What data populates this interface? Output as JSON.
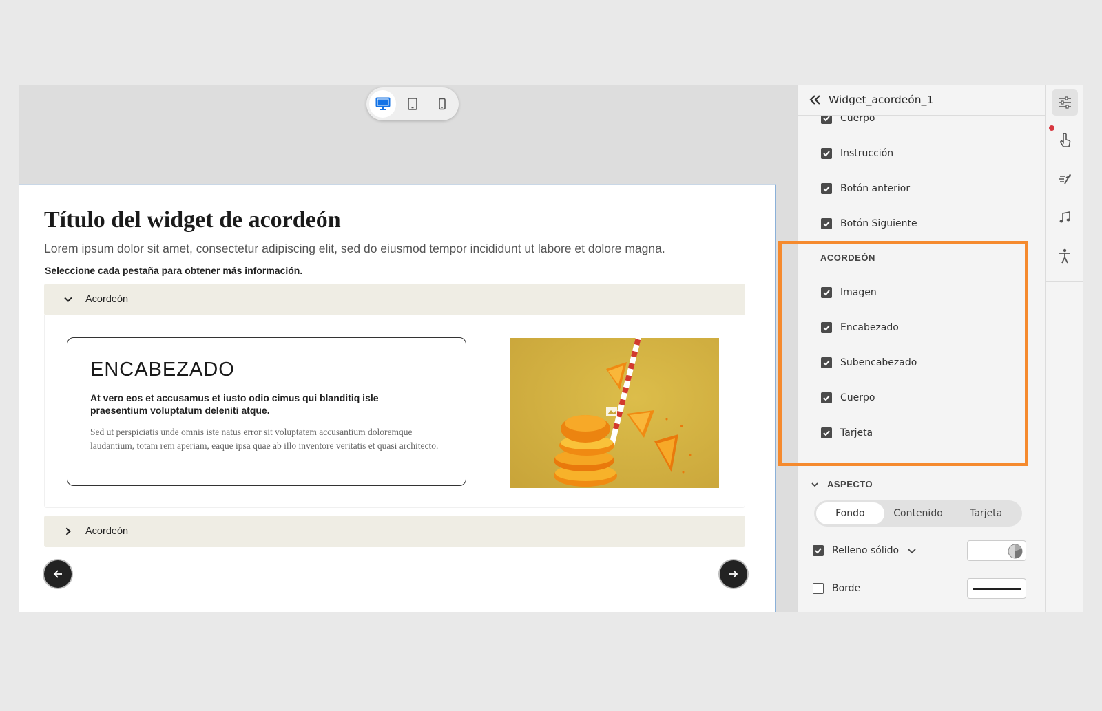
{
  "device_bar": {
    "options": [
      "desktop-icon",
      "tablet-icon",
      "mobile-icon"
    ],
    "active": "desktop-icon",
    "active_color": "#1473e6"
  },
  "widget": {
    "title": "Título del widget de acordeón",
    "description": "Lorem ipsum dolor sit amet, consectetur adipiscing elit, sed do eiusmod tempor incididunt ut labore et dolore magna.",
    "instruction": "Seleccione cada pestaña para obtener más información.",
    "accordions": [
      {
        "label": "Acordeón",
        "expanded": true,
        "card": {
          "heading": "ENCABEZADO",
          "subheading": "At vero eos et accusamus et iusto odio cimus qui blanditiq isle praesentium voluptatum deleniti atque.",
          "body": "Sed ut perspiciatis unde omnis iste natus error sit voluptatem accusantium doloremque laudantium, totam rem aperiam, eaque ipsa quae ab illo inventore veritatis et quasi architecto."
        }
      },
      {
        "label": "Acordeón",
        "expanded": false
      }
    ],
    "accordion_header_color": "#efede4"
  },
  "panel": {
    "title": "Widget_acordeón_1",
    "general_items": [
      {
        "label": "Cuerpo",
        "checked": true
      },
      {
        "label": "Instrucción",
        "checked": true
      },
      {
        "label": "Botón anterior",
        "checked": true
      },
      {
        "label": "Botón Siguiente",
        "checked": true
      }
    ],
    "accordion_section": {
      "title": "ACORDEÓN",
      "items": [
        {
          "label": "Imagen",
          "checked": true
        },
        {
          "label": "Encabezado",
          "checked": true
        },
        {
          "label": "Subencabezado",
          "checked": true
        },
        {
          "label": "Cuerpo",
          "checked": true
        },
        {
          "label": "Tarjeta",
          "checked": true
        }
      ]
    },
    "appearance": {
      "title": "ASPECTO",
      "tabs": [
        "Fondo",
        "Contenido",
        "Tarjeta"
      ],
      "active_tab": "Fondo",
      "solid_fill": {
        "label": "Relleno sólido",
        "checked": true
      },
      "border": {
        "label": "Borde",
        "checked": false
      }
    },
    "highlight_color": "#f58a2e"
  },
  "rail": {
    "icons": [
      "properties-icon",
      "interaction-icon",
      "animation-icon",
      "audio-icon",
      "accessibility-icon"
    ],
    "active": "properties-icon",
    "notification_color": "#d7373f"
  }
}
